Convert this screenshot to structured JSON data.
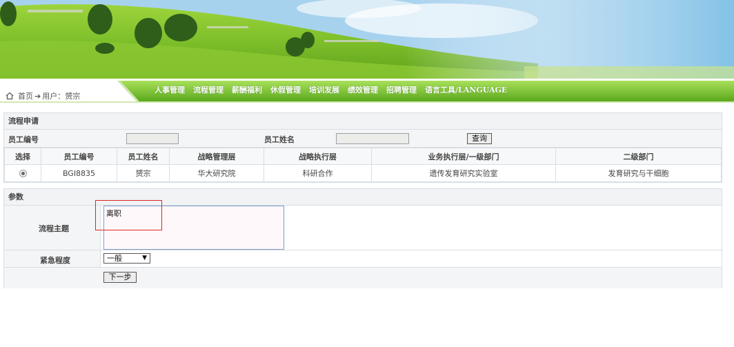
{
  "nav": {
    "items": [
      {
        "label": "人事管理"
      },
      {
        "label": "流程管理"
      },
      {
        "label": "薪酬福利"
      },
      {
        "label": "休假管理"
      },
      {
        "label": "培训发展"
      },
      {
        "label": "绩效管理"
      },
      {
        "label": "招聘管理"
      },
      {
        "label": "语言工具/LANGUAGE"
      }
    ]
  },
  "breadcrumb": {
    "home": "首页",
    "arrow": "➔",
    "user_label": "用户：",
    "user_name": "赟宗"
  },
  "process": {
    "title": "流程申请",
    "search": {
      "employee_id_label": "员工编号",
      "employee_id_value": "",
      "employee_name_label": "员工姓名",
      "employee_name_value": "",
      "query_button": "查询"
    },
    "table": {
      "headers": [
        "选择",
        "员工编号",
        "员工姓名",
        "战略管理层",
        "战略执行层",
        "业务执行层/一级部门",
        "二级部门"
      ],
      "rows": [
        {
          "selected": true,
          "id": "BGI8835",
          "name": "赟宗",
          "strategy_mgmt": "华大研究院",
          "strategy_exec": "科研合作",
          "dept1": "遗传发育研究实验室",
          "dept2": "发育研究与干细胞"
        }
      ]
    }
  },
  "params": {
    "title": "参数",
    "subject_label": "流程主题",
    "subject_value": "离职",
    "urgency_label": "紧急程度",
    "urgency_value": "一般",
    "next_button": "下一步"
  },
  "colors": {
    "nav_green": "#7cc23a",
    "border": "#d8dee3",
    "highlight_red": "#d22222"
  }
}
